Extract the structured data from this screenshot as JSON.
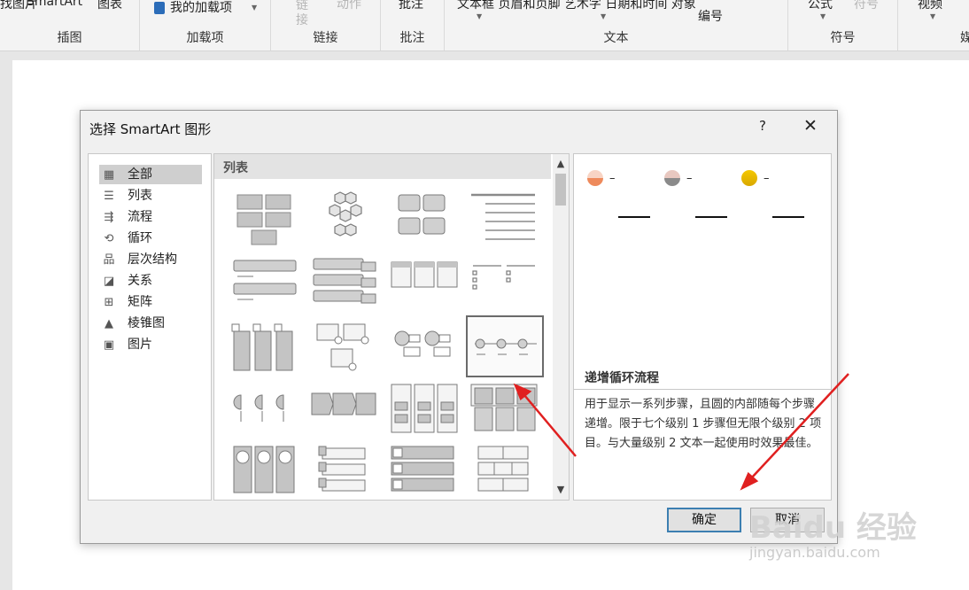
{
  "ribbon": {
    "top_texts": [
      "找图片",
      "SmartArt",
      "图表"
    ],
    "my_addins": "我的加载项",
    "link_text": "链\n接",
    "action_text": "动作",
    "comment_text": "批注",
    "text_group_items": "文本框 页眉和页脚 艺术字 日期和时间 对象",
    "textgroup_second": "编号",
    "symbol_items": [
      "公式",
      "符号"
    ],
    "view_item": "视频",
    "groups": [
      {
        "name": "插图"
      },
      {
        "name": "加载项"
      },
      {
        "name": "链接"
      },
      {
        "name": "批注"
      },
      {
        "name": "文本"
      },
      {
        "name": "符号"
      },
      {
        "name": "媒"
      }
    ]
  },
  "dialog": {
    "title": "选择 SmartArt 图形",
    "help": "?",
    "close": "✕",
    "categories": [
      {
        "label": "全部",
        "icon": "all-icon",
        "glyph": "▦",
        "selected": true
      },
      {
        "label": "列表",
        "icon": "list-icon",
        "glyph": "☰"
      },
      {
        "label": "流程",
        "icon": "process-icon",
        "glyph": "⇶"
      },
      {
        "label": "循环",
        "icon": "cycle-icon",
        "glyph": "⟲"
      },
      {
        "label": "层次结构",
        "icon": "hierarchy-icon",
        "glyph": "品"
      },
      {
        "label": "关系",
        "icon": "relationship-icon",
        "glyph": "◪"
      },
      {
        "label": "矩阵",
        "icon": "matrix-icon",
        "glyph": "⊞"
      },
      {
        "label": "棱锥图",
        "icon": "pyramid-icon",
        "glyph": "▲"
      },
      {
        "label": "图片",
        "icon": "picture-icon",
        "glyph": "▣"
      }
    ],
    "gallery": {
      "header": "列表",
      "selected_index": 11
    },
    "preview": {
      "name": "递增循环流程",
      "description": "用于显示一系列步骤，且圆的内部随每个步骤递增。限于七个级别 1 步骤但无限个级别 2 项目。与大量级别 2 文本一起使用时效果最佳。",
      "bullet_text": "–",
      "circle_colors": [
        "#f3a07a",
        "#9a9a9a",
        "#e8b800"
      ]
    },
    "buttons": {
      "ok": "确定",
      "cancel": "取消"
    }
  },
  "watermark": {
    "brand": "Baidu 经验",
    "url": "jingyan.baidu.com"
  },
  "colors": {
    "annotation_arrow": "#e02020",
    "ok_border": "#3c7fb1"
  }
}
